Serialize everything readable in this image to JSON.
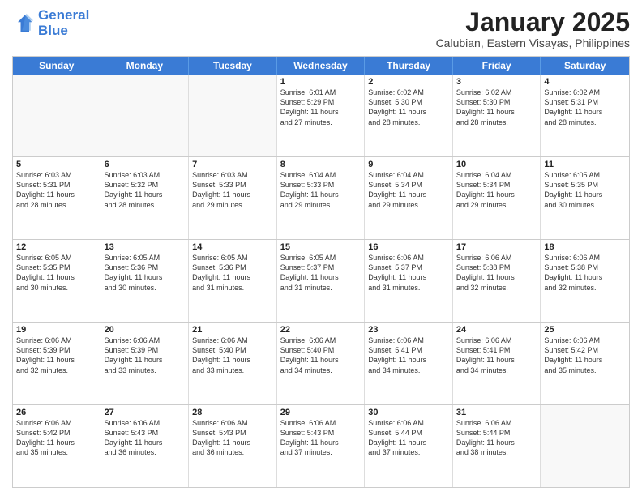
{
  "logo": {
    "line1": "General",
    "line2": "Blue"
  },
  "title": "January 2025",
  "subtitle": "Calubian, Eastern Visayas, Philippines",
  "days_header": [
    "Sunday",
    "Monday",
    "Tuesday",
    "Wednesday",
    "Thursday",
    "Friday",
    "Saturday"
  ],
  "weeks": [
    [
      {
        "day": "",
        "info": ""
      },
      {
        "day": "",
        "info": ""
      },
      {
        "day": "",
        "info": ""
      },
      {
        "day": "1",
        "info": "Sunrise: 6:01 AM\nSunset: 5:29 PM\nDaylight: 11 hours\nand 27 minutes."
      },
      {
        "day": "2",
        "info": "Sunrise: 6:02 AM\nSunset: 5:30 PM\nDaylight: 11 hours\nand 28 minutes."
      },
      {
        "day": "3",
        "info": "Sunrise: 6:02 AM\nSunset: 5:30 PM\nDaylight: 11 hours\nand 28 minutes."
      },
      {
        "day": "4",
        "info": "Sunrise: 6:02 AM\nSunset: 5:31 PM\nDaylight: 11 hours\nand 28 minutes."
      }
    ],
    [
      {
        "day": "5",
        "info": "Sunrise: 6:03 AM\nSunset: 5:31 PM\nDaylight: 11 hours\nand 28 minutes."
      },
      {
        "day": "6",
        "info": "Sunrise: 6:03 AM\nSunset: 5:32 PM\nDaylight: 11 hours\nand 28 minutes."
      },
      {
        "day": "7",
        "info": "Sunrise: 6:03 AM\nSunset: 5:33 PM\nDaylight: 11 hours\nand 29 minutes."
      },
      {
        "day": "8",
        "info": "Sunrise: 6:04 AM\nSunset: 5:33 PM\nDaylight: 11 hours\nand 29 minutes."
      },
      {
        "day": "9",
        "info": "Sunrise: 6:04 AM\nSunset: 5:34 PM\nDaylight: 11 hours\nand 29 minutes."
      },
      {
        "day": "10",
        "info": "Sunrise: 6:04 AM\nSunset: 5:34 PM\nDaylight: 11 hours\nand 29 minutes."
      },
      {
        "day": "11",
        "info": "Sunrise: 6:05 AM\nSunset: 5:35 PM\nDaylight: 11 hours\nand 30 minutes."
      }
    ],
    [
      {
        "day": "12",
        "info": "Sunrise: 6:05 AM\nSunset: 5:35 PM\nDaylight: 11 hours\nand 30 minutes."
      },
      {
        "day": "13",
        "info": "Sunrise: 6:05 AM\nSunset: 5:36 PM\nDaylight: 11 hours\nand 30 minutes."
      },
      {
        "day": "14",
        "info": "Sunrise: 6:05 AM\nSunset: 5:36 PM\nDaylight: 11 hours\nand 31 minutes."
      },
      {
        "day": "15",
        "info": "Sunrise: 6:05 AM\nSunset: 5:37 PM\nDaylight: 11 hours\nand 31 minutes."
      },
      {
        "day": "16",
        "info": "Sunrise: 6:06 AM\nSunset: 5:37 PM\nDaylight: 11 hours\nand 31 minutes."
      },
      {
        "day": "17",
        "info": "Sunrise: 6:06 AM\nSunset: 5:38 PM\nDaylight: 11 hours\nand 32 minutes."
      },
      {
        "day": "18",
        "info": "Sunrise: 6:06 AM\nSunset: 5:38 PM\nDaylight: 11 hours\nand 32 minutes."
      }
    ],
    [
      {
        "day": "19",
        "info": "Sunrise: 6:06 AM\nSunset: 5:39 PM\nDaylight: 11 hours\nand 32 minutes."
      },
      {
        "day": "20",
        "info": "Sunrise: 6:06 AM\nSunset: 5:39 PM\nDaylight: 11 hours\nand 33 minutes."
      },
      {
        "day": "21",
        "info": "Sunrise: 6:06 AM\nSunset: 5:40 PM\nDaylight: 11 hours\nand 33 minutes."
      },
      {
        "day": "22",
        "info": "Sunrise: 6:06 AM\nSunset: 5:40 PM\nDaylight: 11 hours\nand 34 minutes."
      },
      {
        "day": "23",
        "info": "Sunrise: 6:06 AM\nSunset: 5:41 PM\nDaylight: 11 hours\nand 34 minutes."
      },
      {
        "day": "24",
        "info": "Sunrise: 6:06 AM\nSunset: 5:41 PM\nDaylight: 11 hours\nand 34 minutes."
      },
      {
        "day": "25",
        "info": "Sunrise: 6:06 AM\nSunset: 5:42 PM\nDaylight: 11 hours\nand 35 minutes."
      }
    ],
    [
      {
        "day": "26",
        "info": "Sunrise: 6:06 AM\nSunset: 5:42 PM\nDaylight: 11 hours\nand 35 minutes."
      },
      {
        "day": "27",
        "info": "Sunrise: 6:06 AM\nSunset: 5:43 PM\nDaylight: 11 hours\nand 36 minutes."
      },
      {
        "day": "28",
        "info": "Sunrise: 6:06 AM\nSunset: 5:43 PM\nDaylight: 11 hours\nand 36 minutes."
      },
      {
        "day": "29",
        "info": "Sunrise: 6:06 AM\nSunset: 5:43 PM\nDaylight: 11 hours\nand 37 minutes."
      },
      {
        "day": "30",
        "info": "Sunrise: 6:06 AM\nSunset: 5:44 PM\nDaylight: 11 hours\nand 37 minutes."
      },
      {
        "day": "31",
        "info": "Sunrise: 6:06 AM\nSunset: 5:44 PM\nDaylight: 11 hours\nand 38 minutes."
      },
      {
        "day": "",
        "info": ""
      }
    ]
  ]
}
